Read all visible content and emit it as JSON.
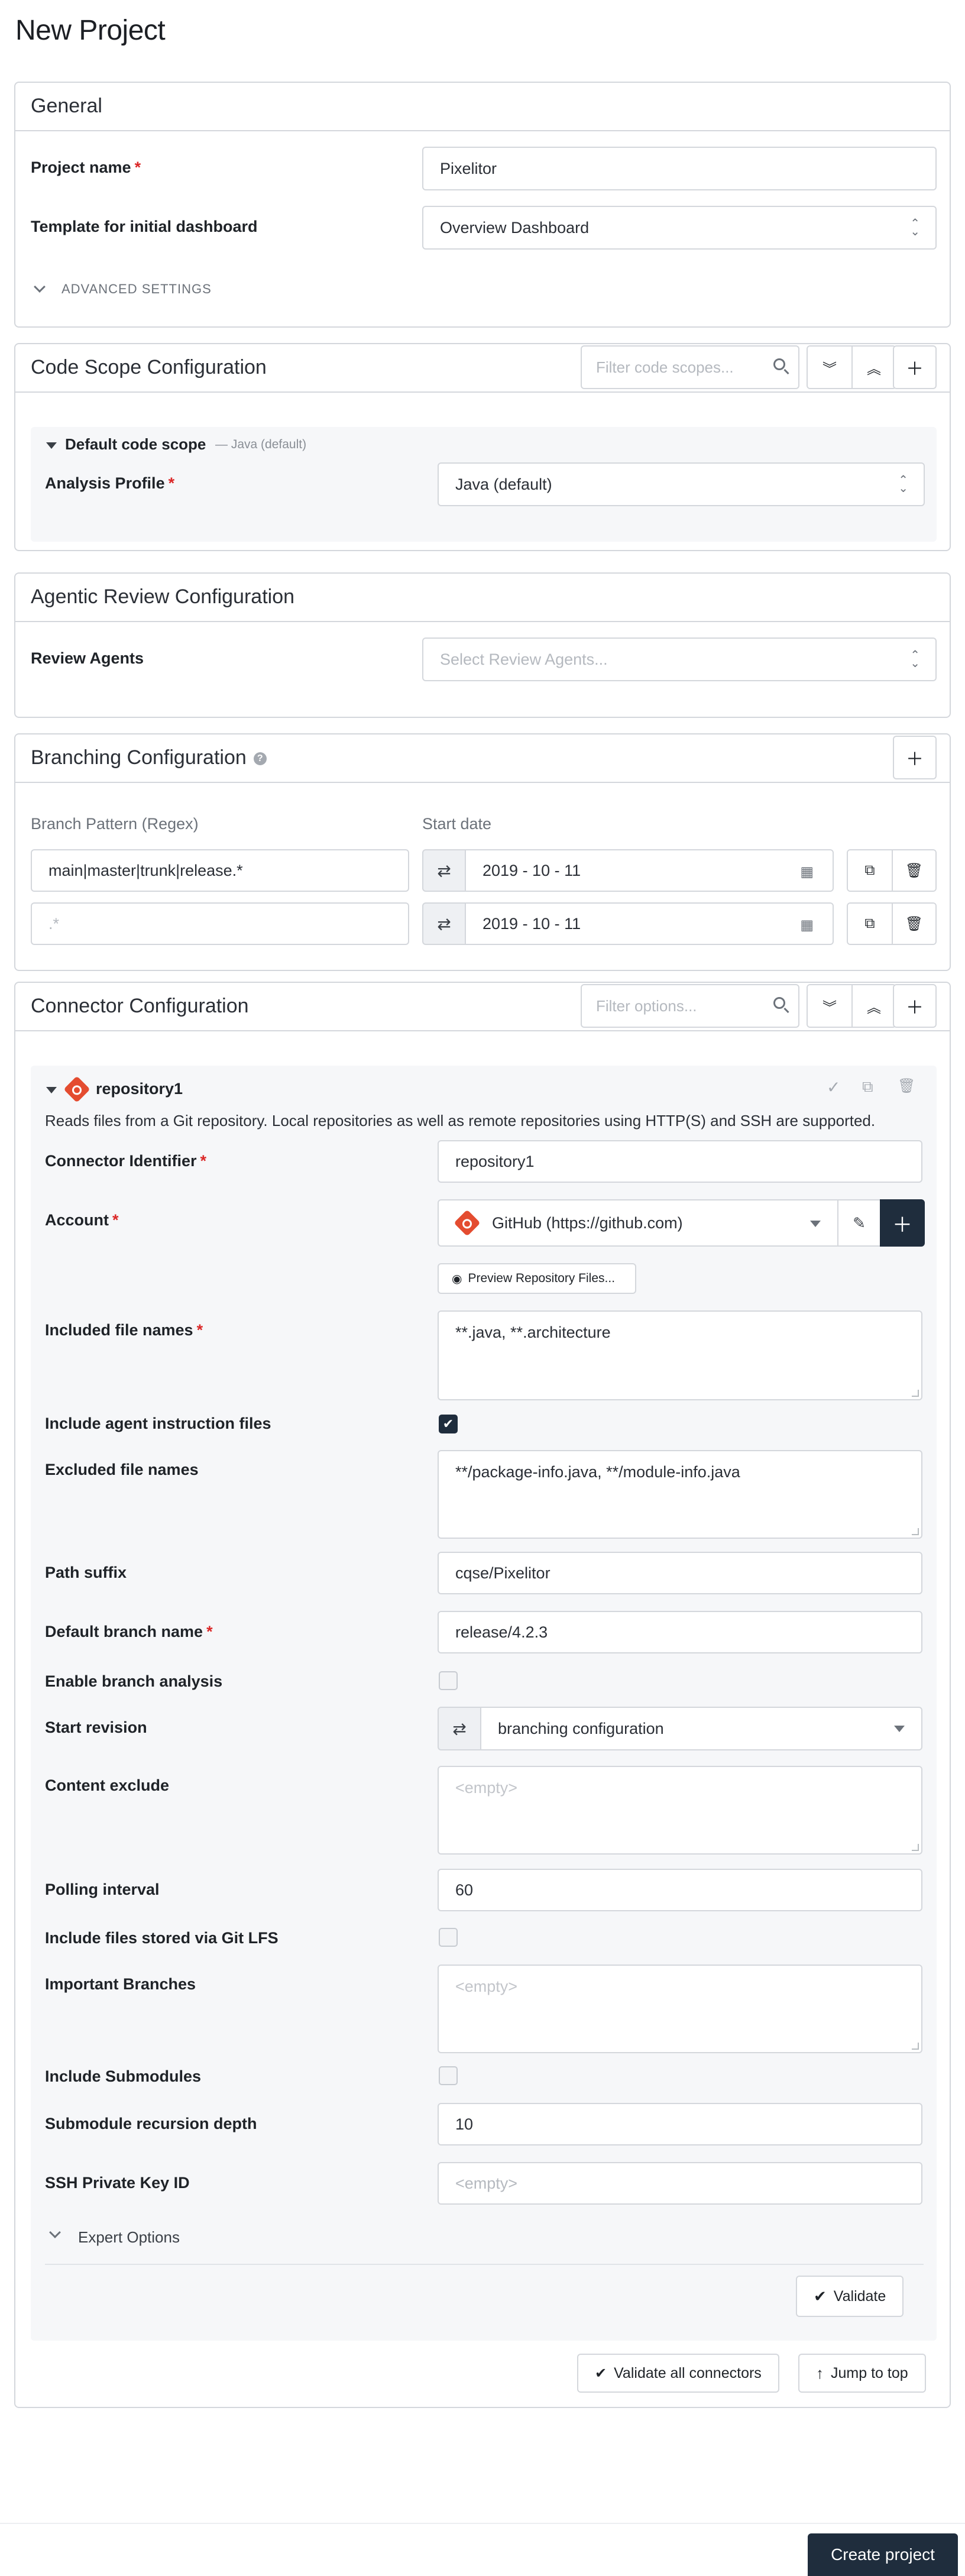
{
  "page": {
    "title": "New Project"
  },
  "general": {
    "title": "General",
    "project_name_label": "Project name",
    "project_name_value": "Pixelitor",
    "template_label": "Template for initial dashboard",
    "template_value": "Overview Dashboard",
    "advanced_label": "ADVANCED SETTINGS"
  },
  "code_scope": {
    "title": "Code Scope Configuration",
    "filter_placeholder": "Filter code scopes...",
    "scope_name": "Default code scope",
    "scope_hint": "— Java (default)",
    "profile_label": "Analysis Profile",
    "profile_value": "Java (default)"
  },
  "agentic": {
    "title": "Agentic Review Configuration",
    "agents_label": "Review Agents",
    "agents_placeholder": "Select Review Agents..."
  },
  "branching": {
    "title": "Branching Configuration",
    "col_pattern": "Branch Pattern (Regex)",
    "col_date": "Start date",
    "rows": [
      {
        "pattern": "main|master|trunk|release.*",
        "date": "2019 - 10 - 11"
      },
      {
        "pattern": ".*",
        "date": "2019 - 10 - 11"
      }
    ]
  },
  "connector": {
    "title": "Connector Configuration",
    "filter_placeholder": "Filter options...",
    "repo_name": "repository1",
    "description": "Reads files from a Git repository. Local repositories as well as remote repositories using HTTP(S) and SSH are supported.",
    "identifier_label": "Connector Identifier",
    "identifier_value": "repository1",
    "account_label": "Account",
    "account_value": "GitHub (https://github.com)",
    "preview_label": "Preview Repository Files...",
    "included_label": "Included file names",
    "included_value": "**.java, **.architecture",
    "agent_files_label": "Include agent instruction files",
    "excluded_label": "Excluded file names",
    "excluded_value": "**/package-info.java, **/module-info.java",
    "path_suffix_label": "Path suffix",
    "path_suffix_value": "cqse/Pixelitor",
    "default_branch_label": "Default branch name",
    "default_branch_value": "release/4.2.3",
    "branch_analysis_label": "Enable branch analysis",
    "start_revision_label": "Start revision",
    "start_revision_value": "branching configuration",
    "content_exclude_label": "Content exclude",
    "empty_placeholder": "<empty>",
    "polling_label": "Polling interval",
    "polling_value": "60",
    "lfs_label": "Include files stored via Git LFS",
    "important_branches_label": "Important Branches",
    "submodules_label": "Include Submodules",
    "recursion_label": "Submodule recursion depth",
    "recursion_value": "10",
    "ssh_label": "SSH Private Key ID",
    "expert_label": "Expert Options",
    "validate_label": "Validate",
    "validate_all_label": "Validate all connectors",
    "jump_top_label": "Jump to top"
  },
  "footer": {
    "create_label": "Create project"
  },
  "colors": {
    "accent_dark": "#1f2d3d",
    "required": "#db2828",
    "git": "#e44c30"
  }
}
